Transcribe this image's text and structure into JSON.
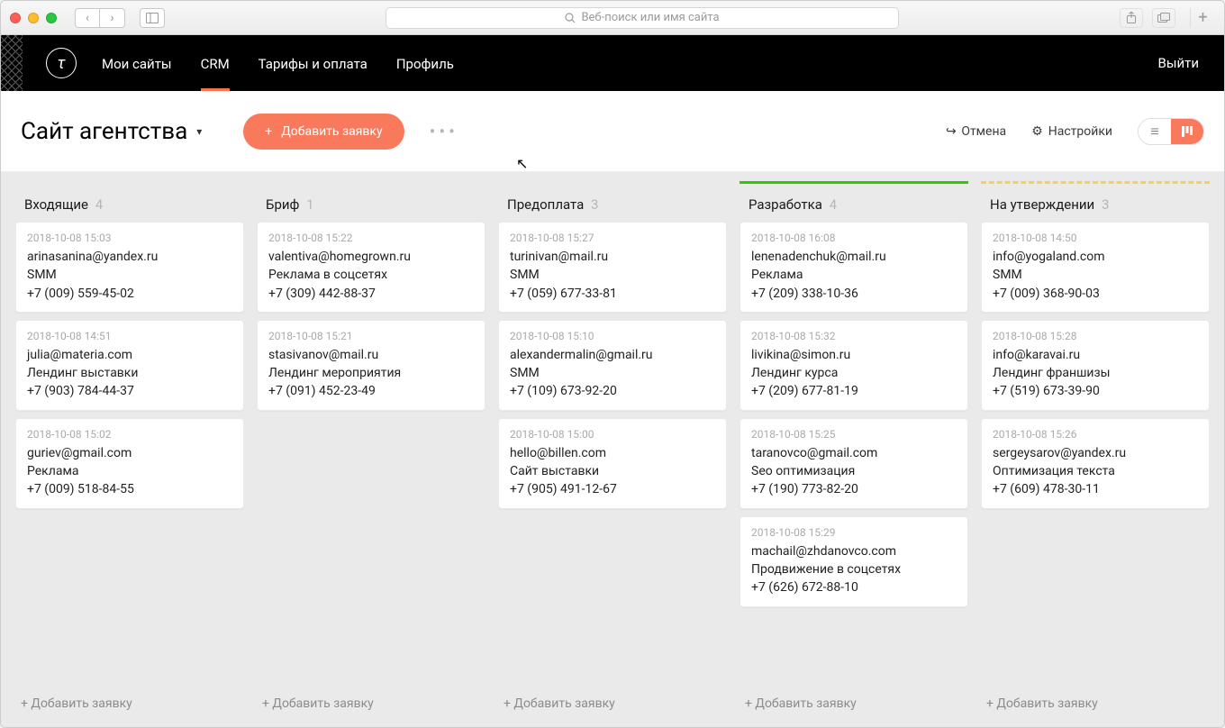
{
  "browser": {
    "search_placeholder": "Веб-поиск или имя сайта"
  },
  "header": {
    "logo_letter": "τ",
    "nav": [
      "Мои сайты",
      "CRM",
      "Тарифы и оплата",
      "Профиль"
    ],
    "active_nav": 1,
    "logout": "Выйти"
  },
  "toolbar": {
    "page_title": "Сайт агентства",
    "add_button": "Добавить заявку",
    "cancel": "Отмена",
    "settings": "Настройки"
  },
  "board": {
    "add_card_label": "+ Добавить заявку",
    "columns": [
      {
        "title": "Входящие",
        "count": "4",
        "accent": "none",
        "cards": [
          {
            "ts": "2018-10-08 15:03",
            "email": "arinasanina@yandex.ru",
            "service": "SMM",
            "phone": "+7 (009) 559-45-02"
          },
          {
            "ts": "2018-10-08 14:51",
            "email": "julia@materia.com",
            "service": "Лендинг выставки",
            "phone": "+7 (903) 784-44-37"
          },
          {
            "ts": "2018-10-08 15:02",
            "email": "guriev@gmail.com",
            "service": "Реклама",
            "phone": "+7 (009) 518-84-55"
          }
        ]
      },
      {
        "title": "Бриф",
        "count": "1",
        "accent": "none",
        "cards": [
          {
            "ts": "2018-10-08 15:22",
            "email": "valentiva@homegrown.ru",
            "service": "Реклама в соцсетях",
            "phone": "+7 (309) 442-88-37"
          },
          {
            "ts": "2018-10-08 15:21",
            "email": "stasivanov@mail.ru",
            "service": "Лендинг мероприятия",
            "phone": "+7 (091) 452-23-49"
          }
        ]
      },
      {
        "title": "Предоплата",
        "count": "3",
        "accent": "none",
        "cards": [
          {
            "ts": "2018-10-08 15:27",
            "email": "turinivan@mail.ru",
            "service": "SMM",
            "phone": "+7 (059) 677-33-81"
          },
          {
            "ts": "2018-10-08 15:10",
            "email": "alexandermalin@gmail.ru",
            "service": "SMM",
            "phone": "+7 (109) 673-92-20"
          },
          {
            "ts": "2018-10-08 15:00",
            "email": "hello@billen.com",
            "service": "Сайт выставки",
            "phone": "+7 (905) 491-12-67"
          }
        ]
      },
      {
        "title": "Разработка",
        "count": "4",
        "accent": "green",
        "cards": [
          {
            "ts": "2018-10-08 16:08",
            "email": "lenenadenchuk@mail.ru",
            "service": "Реклама",
            "phone": "+7 (209) 338-10-36"
          },
          {
            "ts": "2018-10-08 15:32",
            "email": "livikina@simon.ru",
            "service": "Лендинг курса",
            "phone": "+7 (209) 677-81-19"
          },
          {
            "ts": "2018-10-08 15:25",
            "email": "taranovco@gmail.com",
            "service": "Seo оптимизация",
            "phone": "+7 (190) 773-82-20"
          },
          {
            "ts": "2018-10-08 15:29",
            "email": "machail@zhdanovco.com",
            "service": "Продвижение в соцсетях",
            "phone": "+7 (626) 672-88-10"
          }
        ]
      },
      {
        "title": "На утверждении",
        "count": "3",
        "accent": "yellow",
        "cards": [
          {
            "ts": "2018-10-08 14:50",
            "email": "info@yogaland.com",
            "service": "SMM",
            "phone": "+7 (009) 368-90-03"
          },
          {
            "ts": "2018-10-08 15:28",
            "email": "info@karavai.ru",
            "service": "Лендинг франшизы",
            "phone": "+7 (519) 673-39-90"
          },
          {
            "ts": "2018-10-08 15:26",
            "email": "sergeysarov@yandex.ru",
            "service": "Оптимизация текста",
            "phone": "+7 (609) 478-30-11"
          }
        ]
      }
    ]
  }
}
